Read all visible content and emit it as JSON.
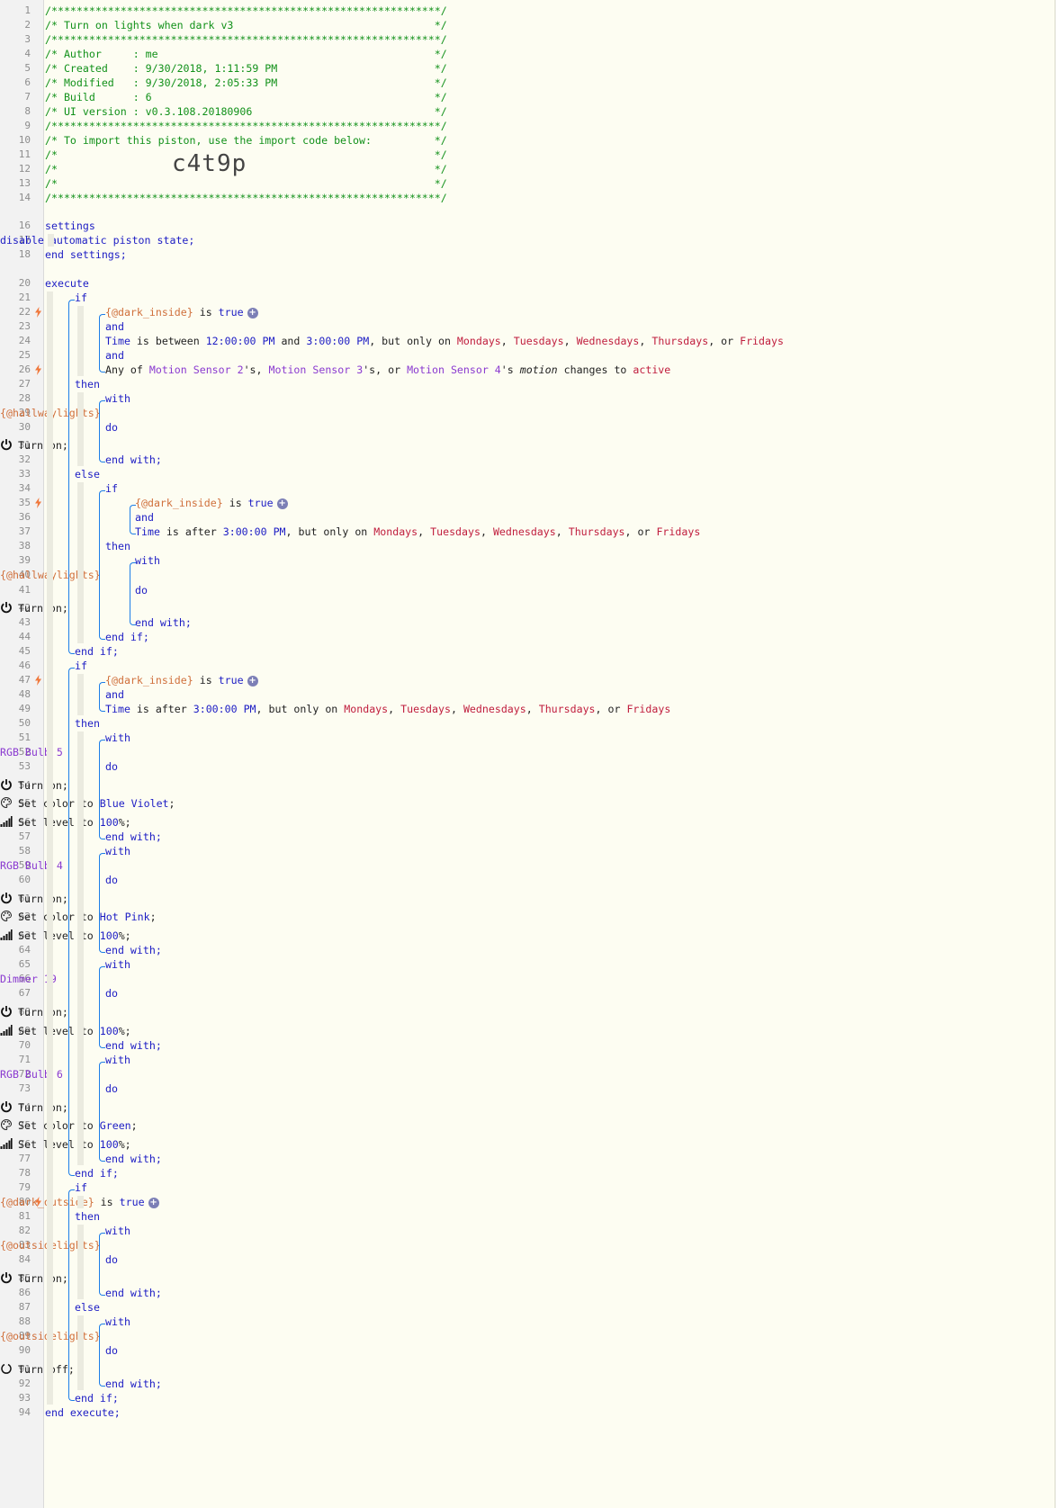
{
  "header_comments": [
    "/**************************************************************/",
    "/* Turn on lights when dark v3                                */",
    "/**************************************************************/",
    "/* Author     : me                                            */",
    "/* Created    : 9/30/2018, 1:11:59 PM                         */",
    "/* Modified   : 9/30/2018, 2:05:33 PM                         */",
    "/* Build      : 6                                             */",
    "/* UI version : v0.3.108.20180906                             */",
    "/**************************************************************/",
    "/* To import this piston, use the import code below:          */",
    "/*                                                            */",
    "/*                                                            */",
    "/*                                                            */",
    "/**************************************************************/"
  ],
  "import_code": "c4t9p",
  "keywords": {
    "settings": "settings",
    "end_settings": "end settings;",
    "disable": "disable automatic piston state;",
    "execute": "execute",
    "end_execute": "end execute;",
    "if": "if",
    "then": "then",
    "else": "else",
    "end_if": "end if;",
    "with": "with",
    "do": "do",
    "end_with": "end with;",
    "and": "and"
  },
  "text": {
    "is_true": " is ",
    "true": "true",
    "time": "Time",
    "is_between": " is between ",
    "and_sep": " and ",
    "is_after": " is after ",
    "but_only_on": ", but only on ",
    "comma": ", ",
    "or": ", or ",
    "any_of": "Any of ",
    "s_comma": "'s, ",
    "s_or": "'s, or ",
    "s": "'s ",
    "motion": "motion",
    "changes_to": " changes to ",
    "active": "active",
    "turn_on": "Turn on;",
    "turn_off": "Turn off;",
    "set_color_to": "Set color to ",
    "set_level_to": "Set level to ",
    "percent": "%;",
    "semicolon": ";"
  },
  "values": {
    "t_12": "12:00:00 PM",
    "t_3": "3:00:00 PM",
    "days": [
      "Mondays",
      "Tuesdays",
      "Wednesdays",
      "Thursdays",
      "Fridays"
    ],
    "level": "100",
    "color_blue_violet": "Blue Violet",
    "color_hot_pink": "Hot Pink",
    "color_green": "Green"
  },
  "variables": {
    "dark_inside": "{@dark_inside}",
    "dark_outside": "{@dark_outside}",
    "hallwaylights": "{@hallwaylights}",
    "outsidelights": "{@outsidelights}"
  },
  "devices": {
    "motion2": "Motion Sensor 2",
    "motion3": "Motion Sensor 3",
    "motion4": "Motion Sensor 4",
    "rgb5": "RGB Bulb 5",
    "rgb4": "RGB Bulb 4",
    "dimmer19": "Dimmer 19",
    "rgb6": "RGB Bulb 6"
  },
  "icons": {
    "power": "power-icon",
    "power_off": "power-off-icon",
    "palette": "palette-icon",
    "level": "level-bars-icon",
    "bolt": "trigger-bolt-icon",
    "plus": "+"
  },
  "colors": {
    "comment": "#12911a",
    "keyword": "#1c1cc4",
    "device": "#8a3ad0",
    "variable": "#d0703c",
    "value_red": "#c01d3d",
    "trigger": "#f0783c",
    "guide": "#1d7ee8"
  }
}
